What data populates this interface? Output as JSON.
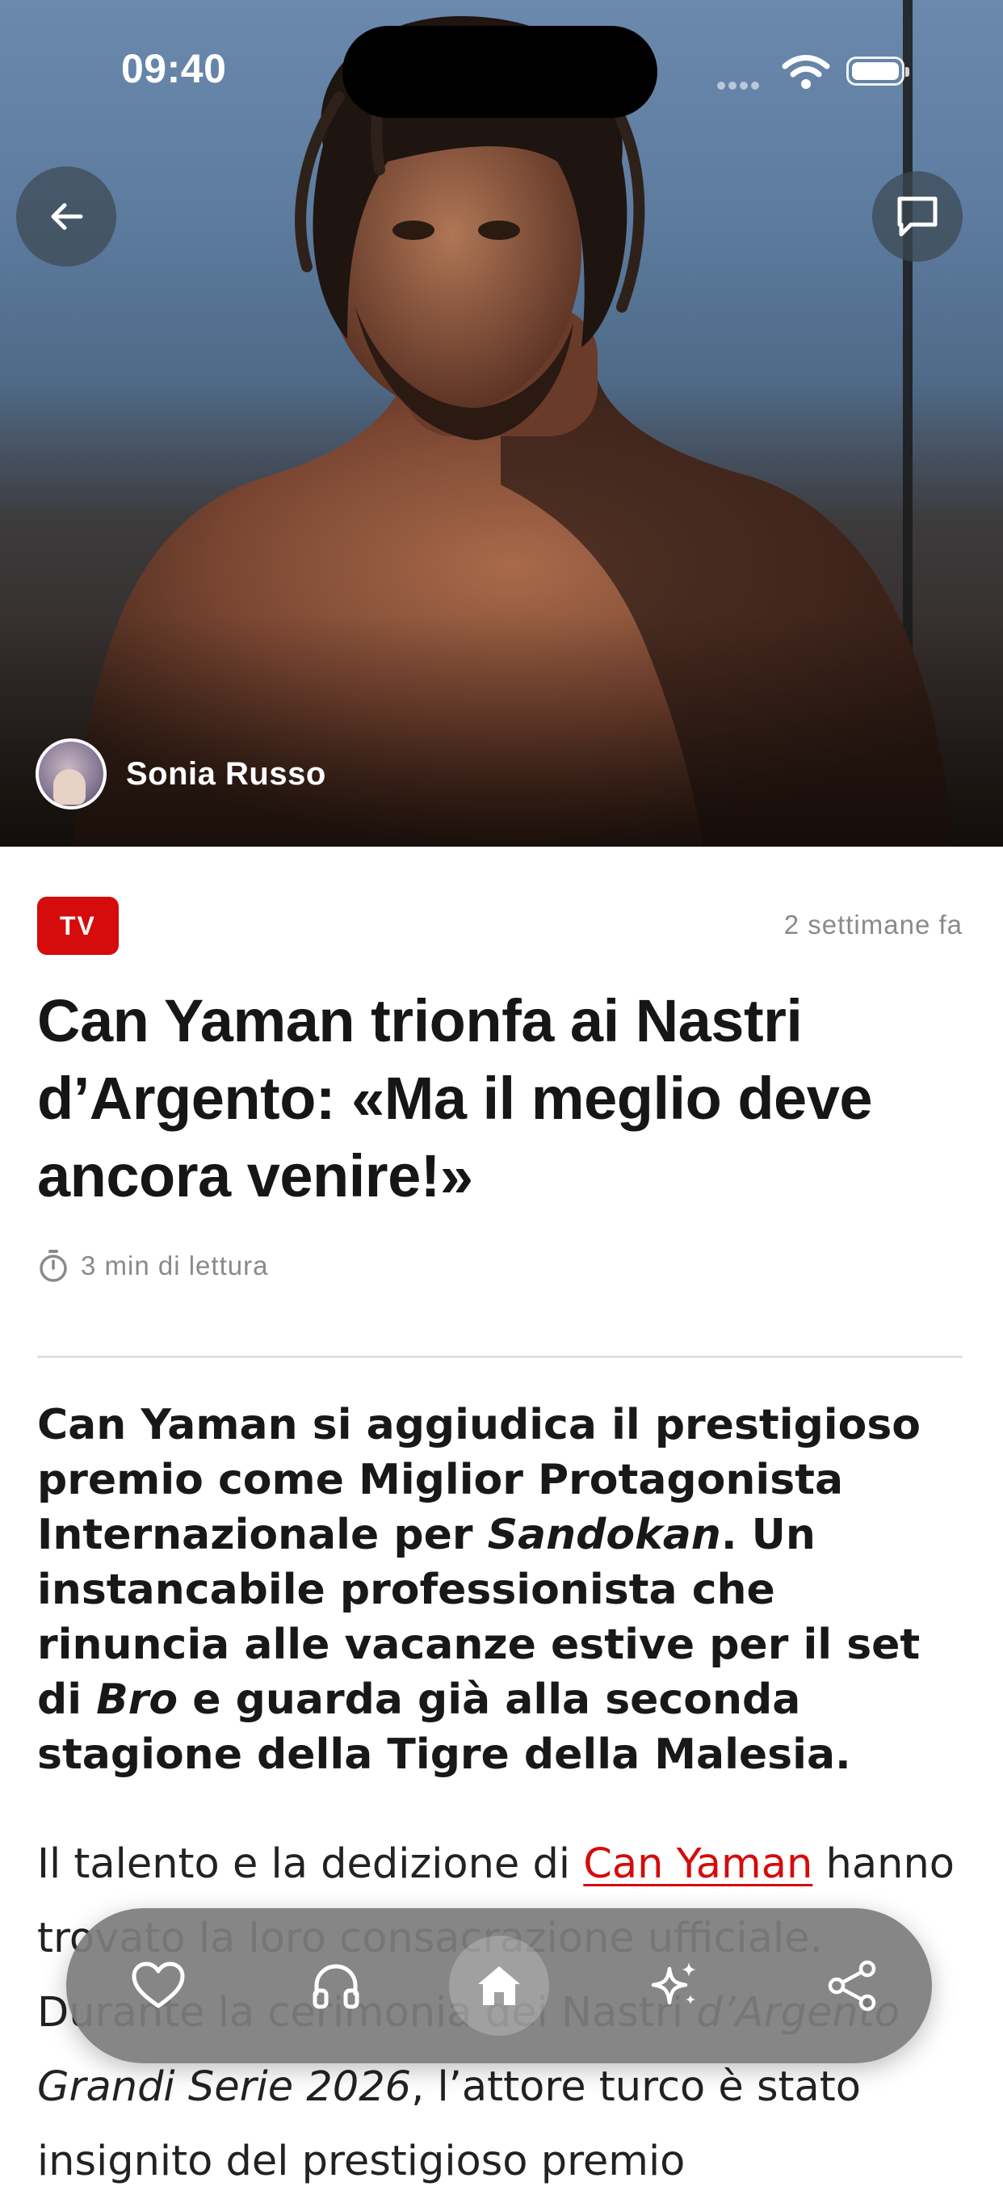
{
  "status_bar": {
    "time": "09:40"
  },
  "hero": {
    "author_name": "Sonia Russo"
  },
  "article": {
    "category": "TV",
    "published": "2 settimane fa",
    "title": "Can Yaman trionfa ai Nastri d’Argento: «Ma il meglio deve ancora venire!»",
    "reading_time": "3 min di lettura",
    "lead": {
      "p1": "Can Yaman si aggiudica il prestigioso premio come Miglior Protagonista Internazionale per ",
      "em1": "Sandokan",
      "p2": ". Un instancabile professionista che rinuncia alle vacanze estive per il set di ",
      "em2": "Bro",
      "p3": " e guarda già alla seconda stagione della Tigre della Malesia."
    },
    "body": {
      "p1": "Il talento e la dedizione di ",
      "link": "Can Yaman",
      "p2": " hanno trovato la loro consacrazione ufficiale. Durante la cerimonia dei Nastri ",
      "em": "d’Argento Grandi Serie 2026",
      "p3": ", l’attore turco è stato insignito del prestigioso premio"
    }
  },
  "dock": {
    "items": [
      {
        "icon": "heart-icon"
      },
      {
        "icon": "headphones-icon"
      },
      {
        "icon": "home-icon",
        "active": true
      },
      {
        "icon": "sparkles-icon"
      },
      {
        "icon": "share-icon"
      }
    ]
  },
  "colors": {
    "accent": "#d60b0b",
    "dock": "#7d7d7d",
    "muted_text": "#8a8a8a"
  }
}
